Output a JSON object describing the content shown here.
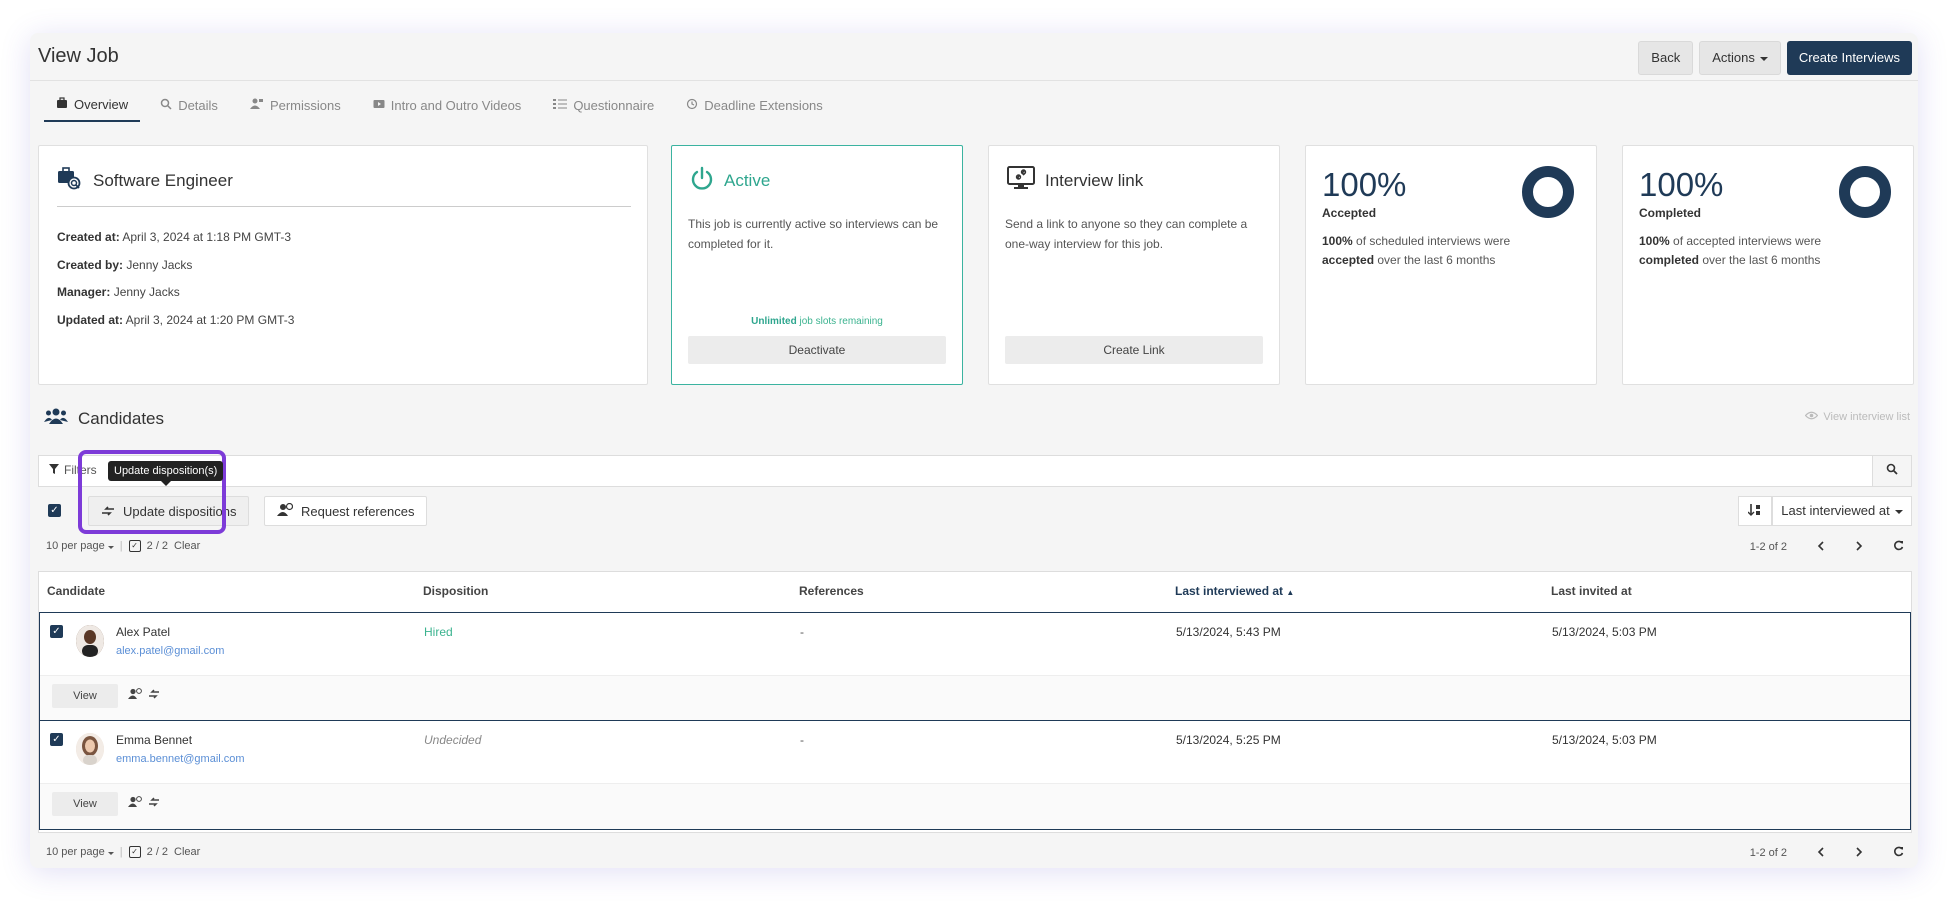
{
  "header": {
    "title": "View Job",
    "back": "Back",
    "actions": "Actions",
    "create": "Create Interviews"
  },
  "tabs": [
    {
      "label": "Overview",
      "icon": "briefcase-icon"
    },
    {
      "label": "Details",
      "icon": "search-icon"
    },
    {
      "label": "Permissions",
      "icon": "user-lock-icon"
    },
    {
      "label": "Intro and Outro Videos",
      "icon": "video-icon"
    },
    {
      "label": "Questionnaire",
      "icon": "list-icon"
    },
    {
      "label": "Deadline Extensions",
      "icon": "history-icon"
    }
  ],
  "job": {
    "title": "Software Engineer",
    "created_at_label": "Created at:",
    "created_at": "April 3, 2024 at 1:18 PM GMT-3",
    "created_by_label": "Created by:",
    "created_by": "Jenny Jacks",
    "manager_label": "Manager:",
    "manager": "Jenny Jacks",
    "updated_at_label": "Updated at:",
    "updated_at": "April 3, 2024 at 1:20 PM GMT-3"
  },
  "active_card": {
    "title": "Active",
    "desc": "This job is currently active so interviews can be completed for it.",
    "slots_strong": "Unlimited",
    "slots_rest": " job slots remaining",
    "button": "Deactivate",
    "accent": "#2ea68e"
  },
  "link_card": {
    "title": "Interview link",
    "desc": "Send a link to anyone so they can complete a one-way interview for this job.",
    "button": "Create Link"
  },
  "stats": [
    {
      "pct": "100%",
      "label": "Accepted",
      "strong": "100%",
      "pre": " of scheduled interviews were ",
      "strong2": "accepted",
      "post": " over the last 6 months",
      "fraction": 1.0
    },
    {
      "pct": "100%",
      "label": "Completed",
      "strong": "100%",
      "pre": " of accepted interviews were ",
      "strong2": "completed",
      "post": " over the last 6 months",
      "fraction": 1.0
    }
  ],
  "candidates": {
    "title": "Candidates",
    "view_list": "View interview list",
    "filters": "Filters",
    "tooltip": "Update disposition(s)",
    "update_btn": "Update dispositions",
    "request_btn": "Request references",
    "sort_label": "Last interviewed at",
    "per_page": "10 per page",
    "selected": "2 / 2",
    "clear": "Clear",
    "range": "1-2  of  2",
    "columns": [
      "Candidate",
      "Disposition",
      "References",
      "Last interviewed at",
      "Last invited at"
    ],
    "rows": [
      {
        "name": "Alex Patel",
        "email": "alex.patel@gmail.com",
        "disposition": "Hired",
        "references": "-",
        "last_interviewed": "5/13/2024, 5:43 PM",
        "last_invited": "5/13/2024, 5:03 PM",
        "view": "View"
      },
      {
        "name": "Emma Bennet",
        "email": "emma.bennet@gmail.com",
        "disposition": "Undecided",
        "references": "-",
        "last_interviewed": "5/13/2024, 5:25 PM",
        "last_invited": "5/13/2024, 5:03 PM",
        "view": "View"
      }
    ]
  },
  "colors": {
    "brand": "#1f3a57",
    "highlight": "#7d3bd8",
    "success": "#3bb38f",
    "link": "#5b8fd6"
  }
}
